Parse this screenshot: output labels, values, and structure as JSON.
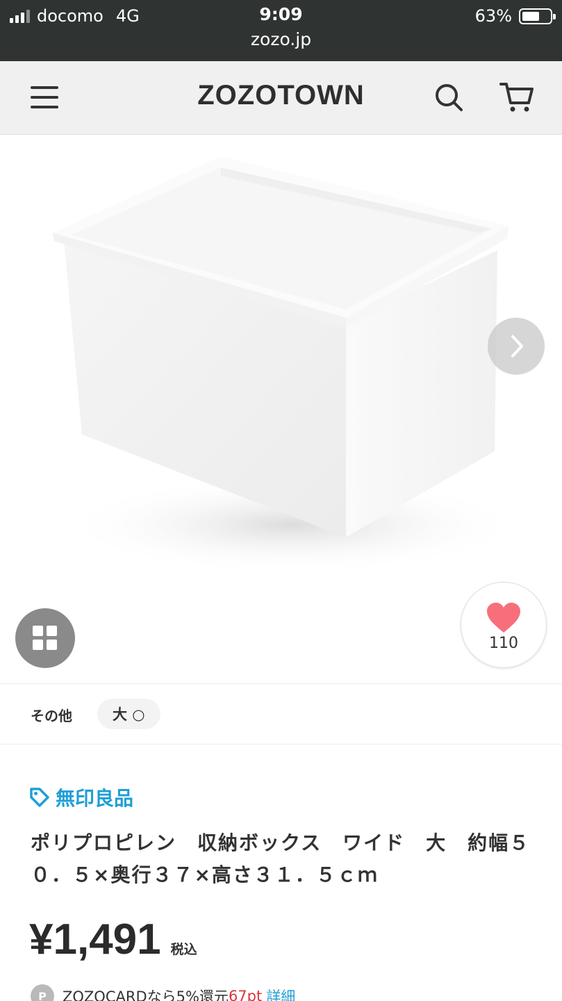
{
  "status_bar": {
    "carrier": "docomo",
    "network": "4G",
    "time": "9:09",
    "url": "zozo.jp",
    "battery": "63%",
    "battery_level": 0.63
  },
  "header": {
    "logo": "ZOZOTOWN",
    "icons": [
      "menu-icon",
      "search-icon",
      "cart-icon"
    ]
  },
  "gallery": {
    "image_subject": "white polypropylene storage box",
    "favorite_count": "110",
    "icons": [
      "chevron-right-icon",
      "grid-icon",
      "heart-icon"
    ]
  },
  "variant": {
    "label": "その他",
    "option": "大 ○"
  },
  "product": {
    "brand": "無印良品",
    "title": "ポリプロピレン　収納ボックス　ワイド　大　約幅５０．５×奥行３７×高さ３１．５ｃｍ",
    "price": "¥1,491",
    "tax_label": "税込"
  },
  "promo": {
    "icon_letter": "P",
    "text": "ZOZOCARDなら5%還元",
    "points": "67pt",
    "link": "詳細"
  },
  "colors": {
    "status_bar_bg": "#2f3433",
    "header_bg": "#f0f0f0",
    "brand_blue": "#1e9fd6",
    "heart": "#f76f7b",
    "points_red": "#d7353f"
  }
}
